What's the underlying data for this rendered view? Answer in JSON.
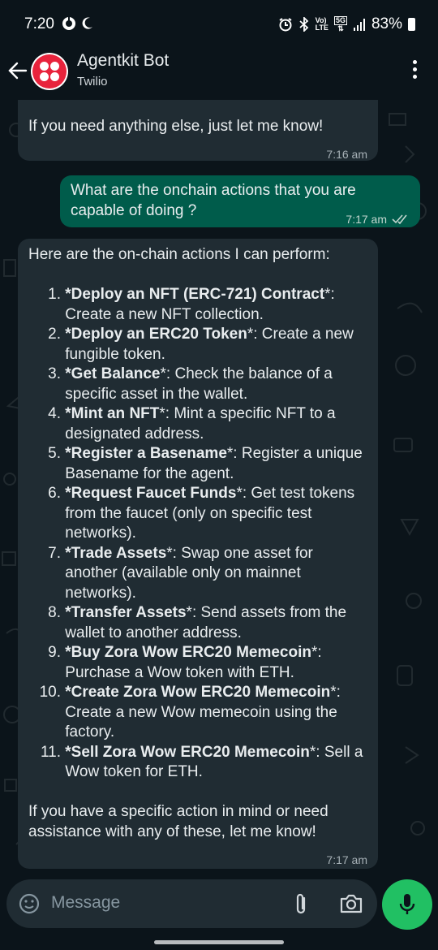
{
  "status_bar": {
    "time": "7:20",
    "volte": "Vo)",
    "lte": "LTE",
    "fiveg": "5G",
    "battery": "83%"
  },
  "header": {
    "name": "Agentkit Bot",
    "subtitle": "Twilio",
    "brand_color": "#e8233c"
  },
  "messages": {
    "m1": {
      "text": "If you need anything else, just let me know!",
      "time": "7:16 am"
    },
    "m2": {
      "text": "What are the onchain actions that you are capable of doing ?",
      "time": "7:17 am"
    },
    "m3": {
      "intro": "Here are the on-chain actions I can perform:",
      "items": [
        {
          "num": "1.",
          "bold": "*Deploy an NFT (ERC-721) Contract",
          "rest": "*: Create a new NFT collection."
        },
        {
          "num": "2.",
          "bold": "*Deploy an ERC20 Token",
          "rest": "*: Create a new fungible token."
        },
        {
          "num": "3.",
          "bold": "*Get Balance",
          "rest": "*: Check the balance of a specific asset in the wallet."
        },
        {
          "num": "4.",
          "bold": "*Mint an NFT",
          "rest": "*: Mint a specific NFT to a designated address."
        },
        {
          "num": "5.",
          "bold": "*Register a Basename",
          "rest": "*: Register a unique Basename for the agent."
        },
        {
          "num": "6.",
          "bold": "*Request Faucet Funds",
          "rest": "*: Get test tokens from the faucet (only on specific test networks)."
        },
        {
          "num": "7.",
          "bold": "*Trade Assets",
          "rest": "*: Swap one asset for another (available only on mainnet networks)."
        },
        {
          "num": "8.",
          "bold": "*Transfer Assets",
          "rest": "*: Send assets from the wallet to another address."
        },
        {
          "num": "9.",
          "bold": "*Buy Zora Wow ERC20 Memecoin",
          "rest": "*: Purchase a Wow token with ETH."
        },
        {
          "num": "10.",
          "bold": "*Create Zora Wow ERC20 Memecoin",
          "rest": "*: Create a new Wow memecoin using the factory."
        },
        {
          "num": "11.",
          "bold": "*Sell Zora Wow ERC20 Memecoin",
          "rest": "*: Sell a Wow token for ETH."
        }
      ],
      "outro": "If you have a specific action in mind or need assistance with any of these, let me know!",
      "time": "7:17 am"
    }
  },
  "composer": {
    "placeholder": "Message",
    "mic_color": "#21c063"
  }
}
